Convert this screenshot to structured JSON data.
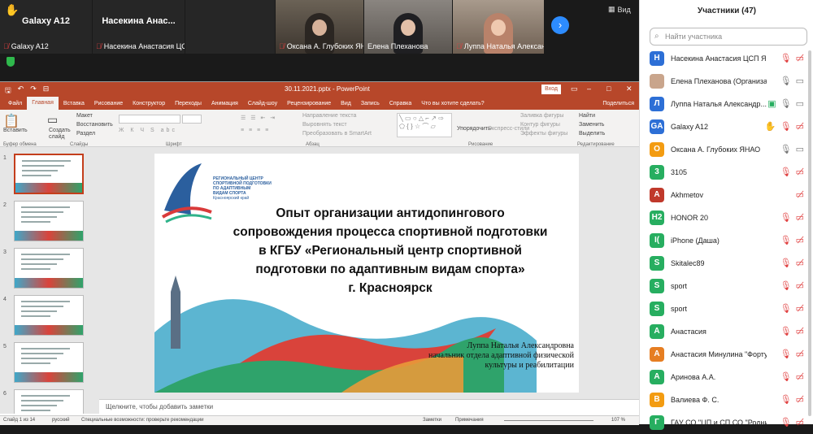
{
  "video": {
    "tiles": [
      {
        "name": "Galaxy A12",
        "footer": "Galaxy A12",
        "hand": true,
        "video": false
      },
      {
        "name": "Насекина  Анас...",
        "footer": "Насекина Анастасия ЦСП Я...",
        "hand": false,
        "video": false
      },
      {
        "name": "",
        "footer": "Оксана А. Глубоких ЯН...",
        "hand": false,
        "video": true
      },
      {
        "name": "",
        "footer": "Елена Плеханова",
        "hand": false,
        "video": true
      },
      {
        "name": "",
        "footer": "Луппа Наталья Алексан...",
        "hand": false,
        "video": true
      }
    ],
    "view_label": "Вид"
  },
  "ppt": {
    "window_title": "30.11.2021.pptx  -  PowerPoint",
    "signin_label": "Вход",
    "tabs": [
      "Файл",
      "Главная",
      "Вставка",
      "Рисование",
      "Конструктор",
      "Переходы",
      "Анимация",
      "Слайд-шоу",
      "Рецензирование",
      "Вид",
      "Запись",
      "Справка",
      "Что вы хотите сделать?"
    ],
    "active_tab": "Главная",
    "share_label": "Поделиться",
    "ribbon": {
      "paste": "Вставить",
      "new_slide": "Создать слайд",
      "layout": "Макет",
      "reset": "Восстановить",
      "section": "Раздел",
      "text_direction": "Направление текста",
      "align_text": "Выровнять текст",
      "smartart": "Преобразовать в SmartArt",
      "arrange": "Упорядочить",
      "quick_styles": "Экспресс-стили",
      "shape_fill": "Заливка фигуры",
      "shape_outline": "Контур фигуры",
      "shape_effects": "Эффекты фигуры",
      "find": "Найти",
      "replace": "Заменить",
      "select": "Выделить",
      "groups": [
        "Буфер обмена",
        "Слайды",
        "Шрифт",
        "Абзац",
        "Рисование",
        "Редактирование"
      ]
    },
    "slide": {
      "logo_lines": [
        "РЕГИОНАЛЬНЫЙ ЦЕНТР",
        "СПОРТИВНОЙ ПОДГОТОВКИ",
        "ПО АДАПТИВНЫМ",
        "ВИДАМ СПОРТА",
        "Красноярский край"
      ],
      "title_lines": [
        "Опыт организации антидопингового",
        "сопровождения процесса спортивной подготовки",
        "в КГБУ «Региональный центр спортивной",
        "подготовки по адаптивным видам спорта»",
        "г. Красноярск"
      ],
      "author_lines": [
        "Луппа Наталья Александровна",
        "начальник отдела адаптивной физической",
        "культуры и реабилитации"
      ]
    },
    "thumb_numbers": [
      "1",
      "2",
      "3",
      "4",
      "5",
      "6"
    ],
    "notes_placeholder": "Щелкните, чтобы добавить заметки",
    "status": {
      "slide_info": "Слайд 1 из 14",
      "language": "русский",
      "accessibility": "Специальные возможности: проверьте рекомендации",
      "notes": "Заметки",
      "comments": "Примечания",
      "zoom": "107 %"
    }
  },
  "participants": {
    "title": "Участники (47)",
    "search_placeholder": "Найти участника",
    "list": [
      {
        "initials": "Н",
        "color": "#2d6fd6",
        "name": "Насекина Анастасия ЦСП Я...  (Я)",
        "icons": [
          "mic-off",
          "cam-off"
        ]
      },
      {
        "initials": "",
        "color": "#c9a58c",
        "name": "Елена Плеханова (Организатор)",
        "icons": [
          "mic-on",
          "cam-on"
        ]
      },
      {
        "initials": "Л",
        "color": "#2d6fd6",
        "name": "Луппа Наталья Александр...",
        "icons": [
          "share",
          "mic-on",
          "cam-on"
        ]
      },
      {
        "initials": "GA",
        "color": "#2d6fd6",
        "name": "Galaxy A12",
        "icons": [
          "hand",
          "mic-off",
          "cam-off"
        ]
      },
      {
        "initials": "О",
        "color": "#f39c12",
        "name": "Оксана А. Глубоких ЯНАО",
        "icons": [
          "mic-on",
          "cam-on"
        ]
      },
      {
        "initials": "3",
        "color": "#27ae60",
        "name": "3105",
        "icons": [
          "mic-off",
          "cam-off"
        ]
      },
      {
        "initials": "A",
        "color": "#c0392b",
        "name": "Akhmetov",
        "icons": [
          "cam-off"
        ]
      },
      {
        "initials": "H2",
        "color": "#27ae60",
        "name": "HONOR 20",
        "icons": [
          "mic-off",
          "cam-off"
        ]
      },
      {
        "initials": "I(",
        "color": "#27ae60",
        "name": "iPhone (Даша)",
        "icons": [
          "mic-off",
          "cam-off"
        ]
      },
      {
        "initials": "S",
        "color": "#27ae60",
        "name": "Skitalec89",
        "icons": [
          "mic-off",
          "cam-off"
        ]
      },
      {
        "initials": "S",
        "color": "#27ae60",
        "name": "sport",
        "icons": [
          "mic-off",
          "cam-off"
        ]
      },
      {
        "initials": "S",
        "color": "#27ae60",
        "name": "sport",
        "icons": [
          "mic-off",
          "cam-off"
        ]
      },
      {
        "initials": "А",
        "color": "#27ae60",
        "name": "Анастасия",
        "icons": [
          "mic-off",
          "cam-off"
        ]
      },
      {
        "initials": "А",
        "color": "#e67e22",
        "name": "Анастасия Минулина \"Фортуна\"",
        "icons": [
          "mic-off",
          "cam-off"
        ]
      },
      {
        "initials": "А",
        "color": "#27ae60",
        "name": "Аринова А.А.",
        "icons": [
          "mic-off",
          "cam-off"
        ]
      },
      {
        "initials": "В",
        "color": "#f39c12",
        "name": "Валиева Ф. С.",
        "icons": [
          "mic-off",
          "cam-off"
        ]
      },
      {
        "initials": "Г",
        "color": "#27ae60",
        "name": "ГАУ СО \"ЦП и СП СО \"Родник\"",
        "icons": [
          "mic-off",
          "cam-off"
        ]
      }
    ]
  }
}
